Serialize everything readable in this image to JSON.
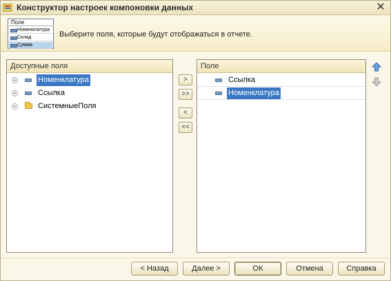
{
  "window": {
    "title": "Конструктор настроек компоновки данных",
    "close_symbol": "✕"
  },
  "header": {
    "preview": {
      "column": "Поле",
      "rows": [
        "Номенклатура",
        "Склад",
        "Сумма"
      ]
    },
    "instruction": "Выберите поля, которые будут отображаться в отчете."
  },
  "available_fields": {
    "header": "Доступные поля",
    "items": [
      {
        "label": "Номенклатура",
        "icon": "field-icon",
        "selected": true
      },
      {
        "label": "Ссылка",
        "icon": "field-icon",
        "selected": false
      },
      {
        "label": "СистемныеПоля",
        "icon": "folder-icon",
        "selected": false
      }
    ]
  },
  "transfer_buttons": {
    "add": ">",
    "add_all": ">>",
    "remove": "<",
    "remove_all": "<<"
  },
  "selected_fields": {
    "header": "Поле",
    "items": [
      {
        "label": "Ссылка",
        "icon": "field-icon",
        "selected": false
      },
      {
        "label": "Номенклатура",
        "icon": "field-icon",
        "selected": true
      }
    ]
  },
  "reorder": {
    "up_icon": "arrow-up-icon",
    "down_icon": "arrow-down-icon"
  },
  "footer": {
    "back": "< Назад",
    "next": "Далее >",
    "ok": "ОК",
    "cancel": "Отмена",
    "help": "Справка"
  },
  "colors": {
    "selection": "#3b78c4",
    "background": "#fbf7e8",
    "header_gradient_end": "#efe4b6"
  }
}
